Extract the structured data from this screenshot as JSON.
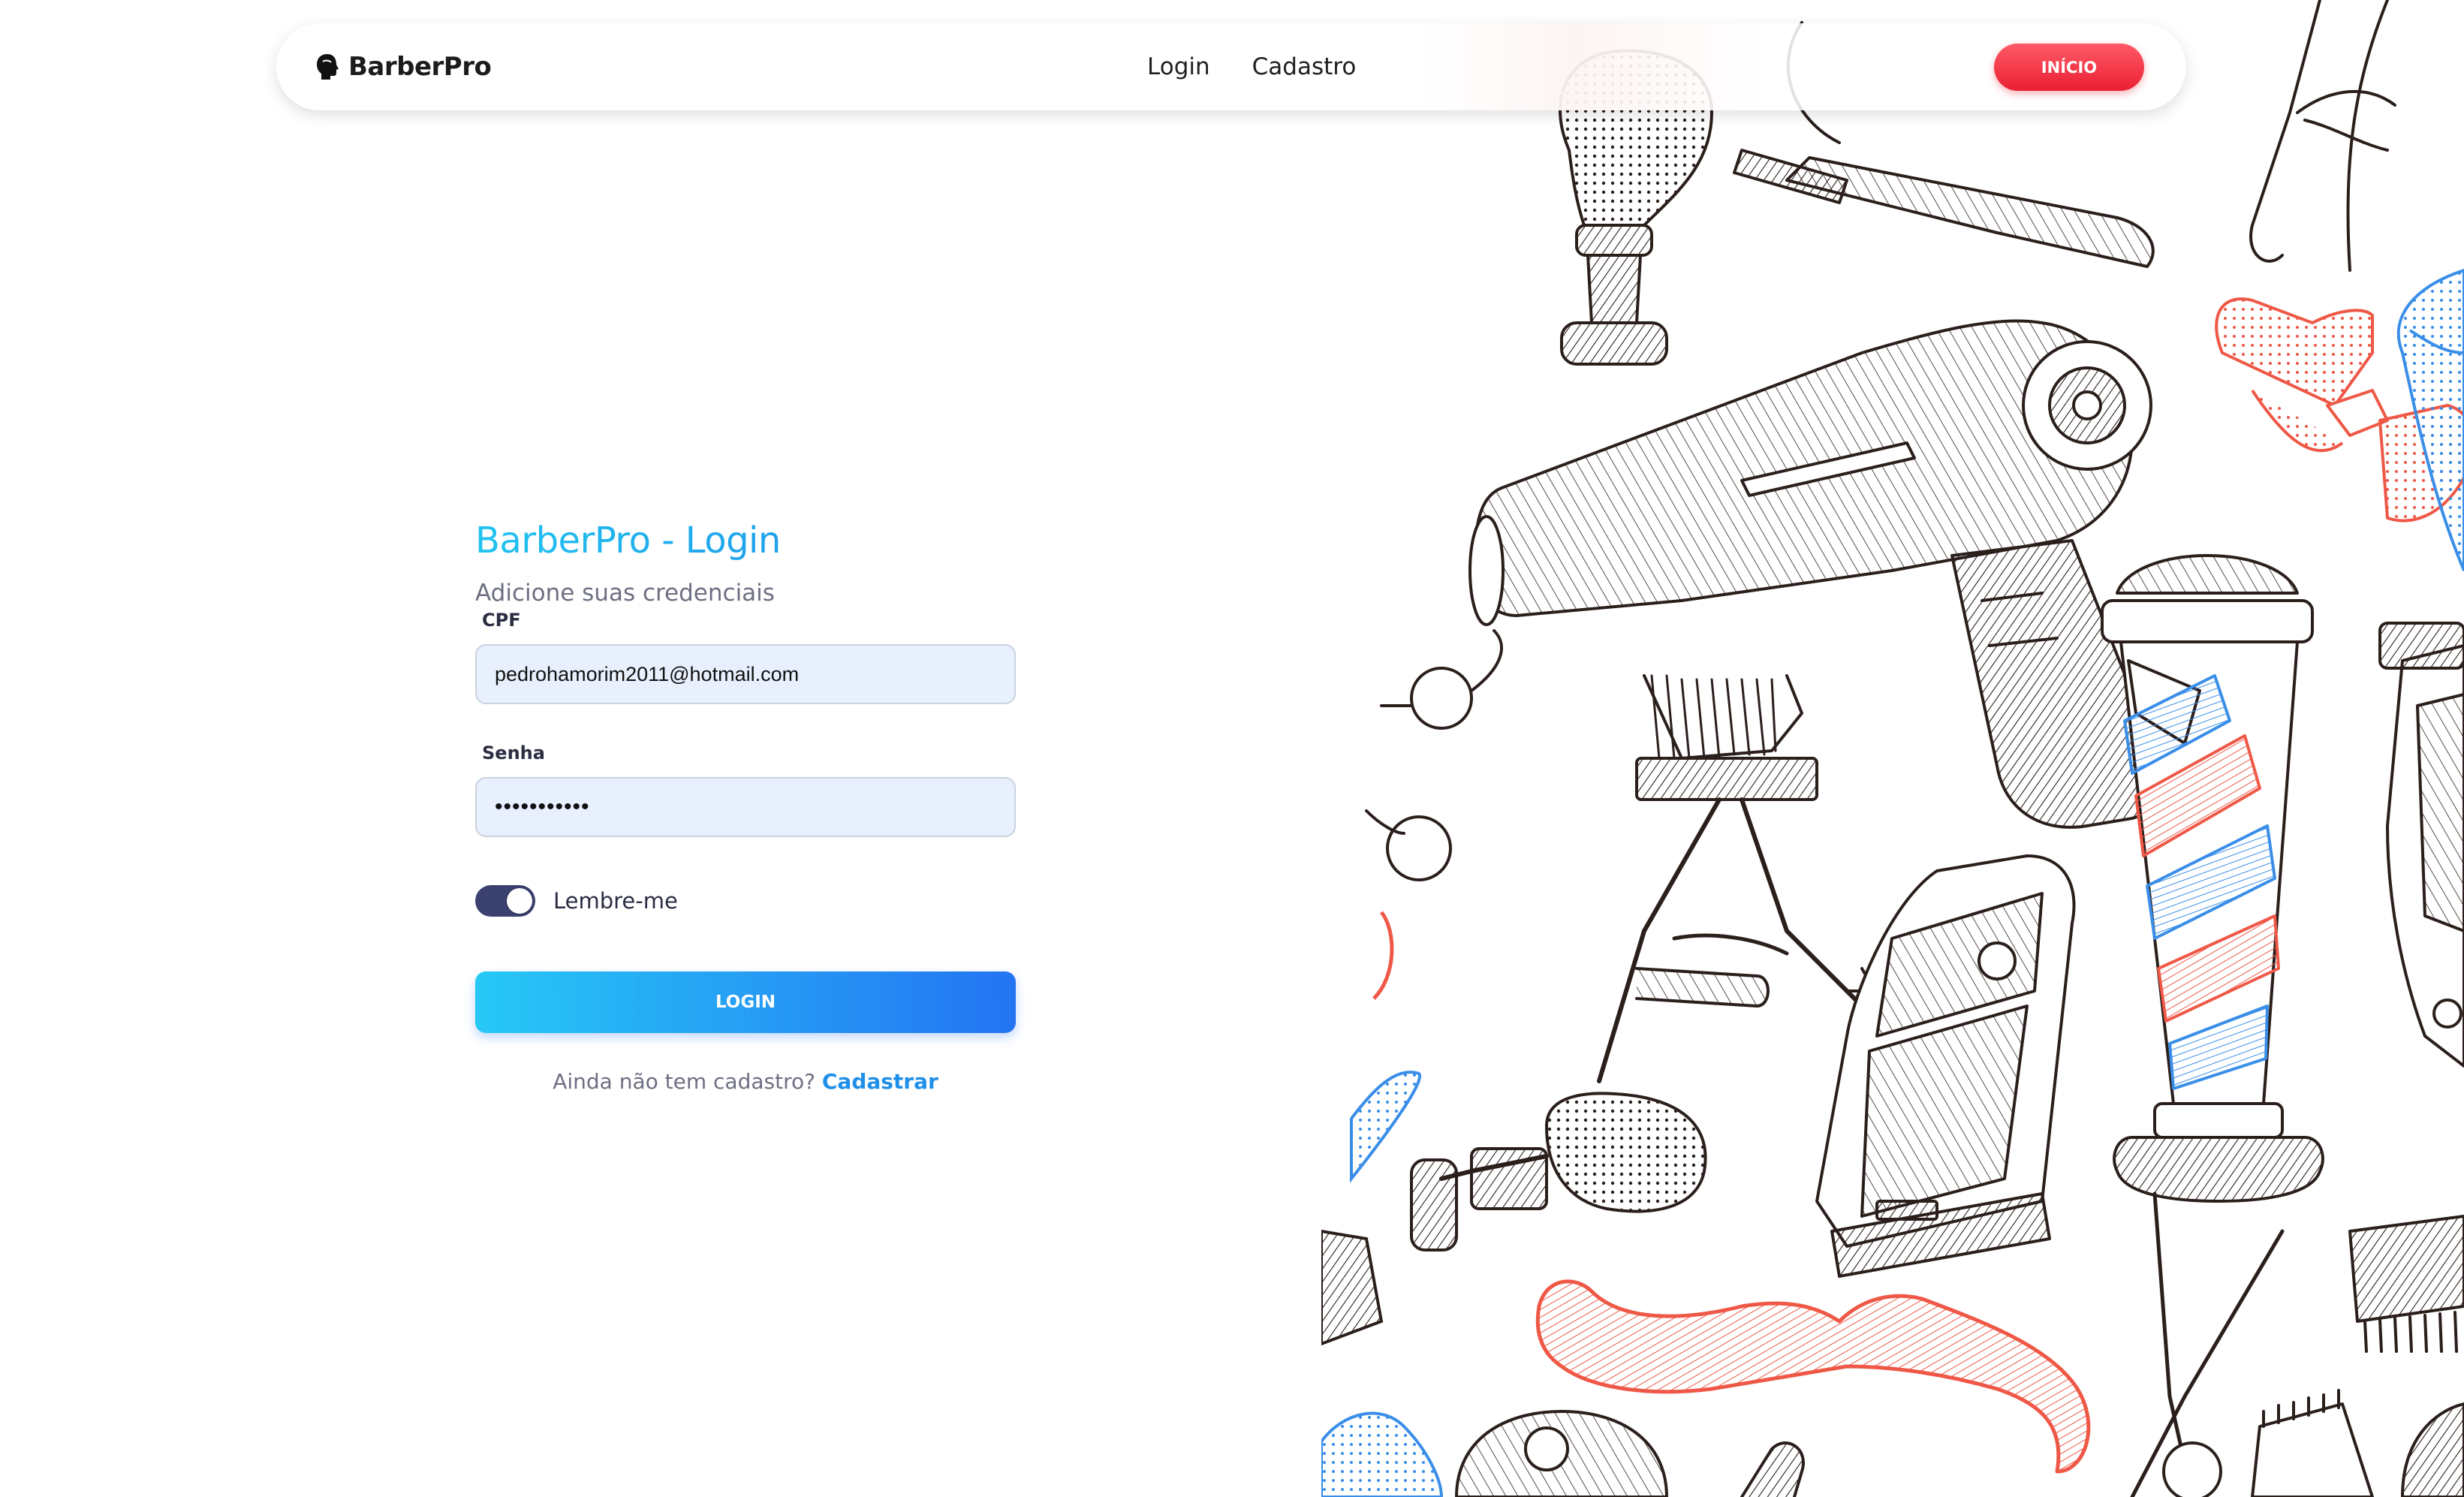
{
  "navbar": {
    "brand": "BarberPro",
    "links": [
      "Login",
      "Cadastro"
    ],
    "cta_label": "INÍCIO"
  },
  "form": {
    "title": "BarberPro - Login",
    "subtitle": "Adicione suas credenciais",
    "cpf_label": "CPF",
    "cpf_value": "pedrohamorim2011@hotmail.com",
    "password_label": "Senha",
    "password_value": "•••••••••••",
    "remember_label": "Lembre-me",
    "remember_checked": true,
    "login_label": "LOGIN",
    "signup_prompt": "Ainda não tem cadastro?",
    "signup_link": "Cadastrar"
  },
  "colors": {
    "accent_blue": "#1f8fe9",
    "accent_cyan": "#27c8f6",
    "cta_red": "#ea1f33",
    "toggle_on": "#3a416f",
    "illustration_red": "#ef5846",
    "illustration_blue": "#3a8ee8",
    "illustration_ink": "#2b1f1c"
  },
  "illustration": {
    "icons": [
      "shaving-brush-icon",
      "straight-razor-icon",
      "hair-dryer-icon",
      "bow-tie-icon",
      "scissors-icon",
      "hair-clipper-icon",
      "barber-pole-icon",
      "electric-trimmer-icon",
      "comb-icon",
      "mustache-icon",
      "beard-icon"
    ]
  }
}
